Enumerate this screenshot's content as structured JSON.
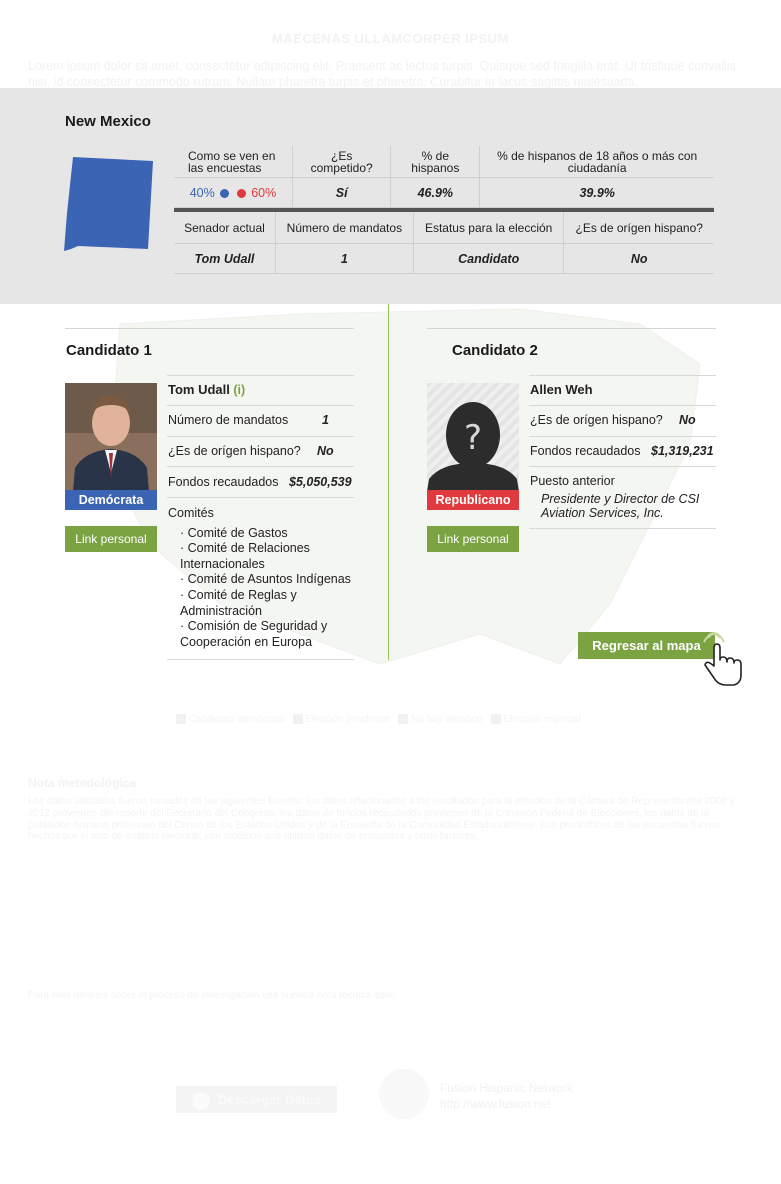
{
  "background": {
    "title": "MAECENAS ULLAMCORPER IPSUM",
    "intro": "Lorem ipsum dolor sit amet, consectetur adipiscing elit. Praesent ac lectus turpis. Quisque sed fringilla erat. Ut tristique convallis nisi, id consectetur commodo rutrum. Nullam pharetra turpis et pharetra. Curabitur in lacus sagittis malesuada."
  },
  "state": {
    "name": "New Mexico",
    "shape_color": "#3c64b4"
  },
  "poll_table": {
    "headers": [
      "Como se ven en las encuestas",
      "¿Es competido?",
      "% de hispanos",
      "% de hispanos de 18 años o más con ciudadanía"
    ],
    "poll_blue": "40%",
    "poll_red": "60%",
    "competitive": "Sí",
    "hispanic_pct": "46.9%",
    "hispanic_adult_pct": "39.9%"
  },
  "senator_table": {
    "headers": [
      "Senador actual",
      "Número de mandatos",
      "Estatus para la elección",
      "¿Es de orígen hispano?"
    ],
    "senator": "Tom Udall",
    "terms": "1",
    "status": "Candidato",
    "hispanic": "No"
  },
  "candidate1": {
    "title": "Candidato 1",
    "name": "Tom Udall",
    "incumbent_mark": "(i)",
    "party": "Demócrata",
    "party_color": "#3c64b4",
    "link_label": "Link personal",
    "terms_label": "Número de mandatos",
    "terms_value": "1",
    "hispanic_label": "¿Es de orígen hispano?",
    "hispanic_value": "No",
    "funds_label": "Fondos recaudados",
    "funds_value": "$5,050,539",
    "committees_label": "Comités",
    "committees": [
      "· Comité de Gastos",
      "· Comité de Relaciones Internacionales",
      "· Comité de Asuntos Indígenas",
      "· Comité de Reglas y Administración",
      "· Comisión de Seguridad y Cooperación en Europa"
    ]
  },
  "candidate2": {
    "title": "Candidato 2",
    "name": "Allen Weh",
    "party": "Republicano",
    "party_color": "#e0393e",
    "link_label": "Link personal",
    "hispanic_label": "¿Es de orígen hispano?",
    "hispanic_value": "No",
    "funds_label": "Fondos recaudados",
    "funds_value": "$1,319,231",
    "prev_label": "Puesto anterior",
    "prev_value": "Presidente y Director de CSI Aviation Services, Inc.",
    "photo_placeholder": "?"
  },
  "back_button": "Regresar al mapa",
  "legend": [
    "Candidato demócrata",
    "Elección pendiente",
    "No hay elección",
    "Elección especial"
  ],
  "methodology": {
    "title": "Nota metodológica",
    "body": "Los datos utilizados fueron tomados de las siguientes fuentes: los datos relacionados a los resultados para la elección de la Cámara de Representantes 2008 y 2012 provienen del reporte del Secretario del Congreso, los datos de fondos recaudados provienen de la Comisión Federal de Elecciones, los datos de la población hispana provienen del Censo de los Estados Unidos y de la Encuesta de la Comunidad Estadounidense. Los pronósticos de las encuestas fueron hechos por el sitio de análisis electoral, con modelos que utilizan datos de encuestas y otros factores.",
    "more": "Para más detalles sobre el proceso de investigación vea nuestra nota técnica aquí."
  },
  "footer": {
    "download": "Descargar Datos",
    "network_name": "Fusion Hispanic Network",
    "network_url": "http://www.fusion.net"
  }
}
